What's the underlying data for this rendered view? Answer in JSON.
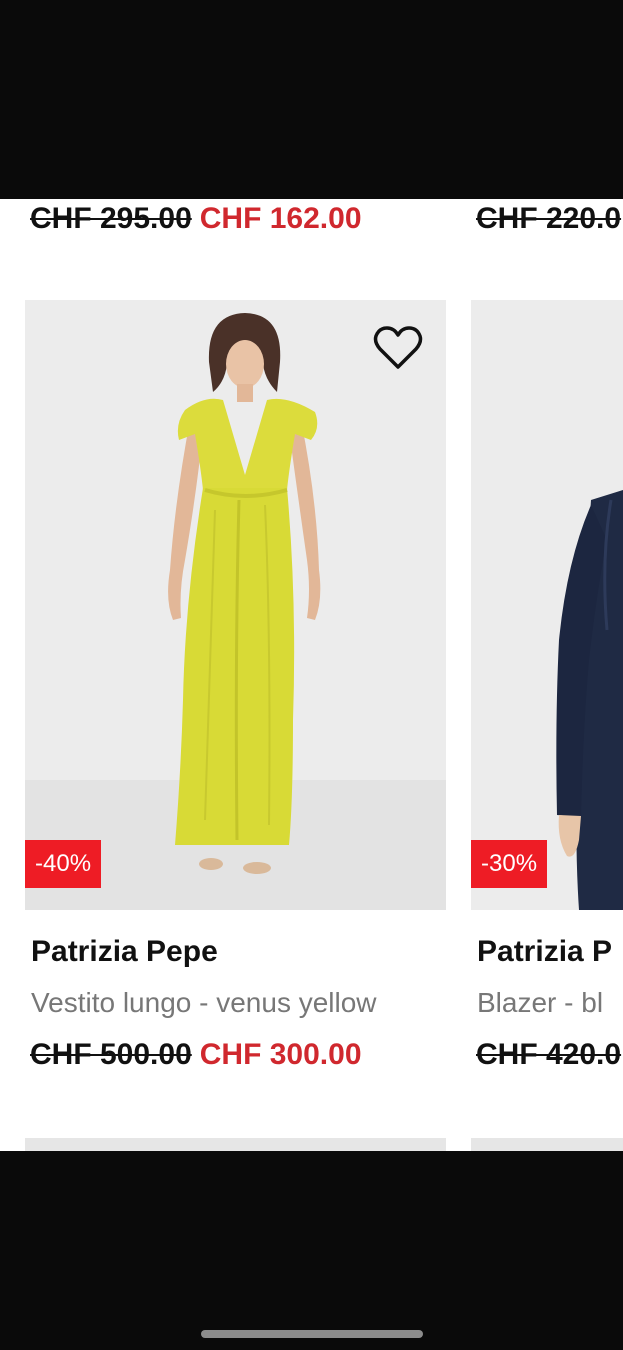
{
  "products": [
    {
      "old_price": "CHF 295.00",
      "new_price": "CHF 162.00"
    },
    {
      "old_price": "CHF 220.0"
    },
    {
      "brand": "Patrizia Pepe",
      "name": "Vestito lungo - venus yellow",
      "old_price": "CHF 500.00",
      "new_price": "CHF 300.00",
      "discount": "-40%",
      "image": "yellow-maxi-dress-photo"
    },
    {
      "brand": "Patrizia P",
      "name": "Blazer - bl",
      "old_price": "CHF 420.0",
      "discount": "-30%",
      "image": "navy-blazer-photo"
    }
  ],
  "icons": {
    "wishlist": "heart-outline-icon"
  },
  "colors": {
    "sale_price": "#d0282e",
    "badge": "#ee1c25",
    "image_background": "#ececec"
  }
}
